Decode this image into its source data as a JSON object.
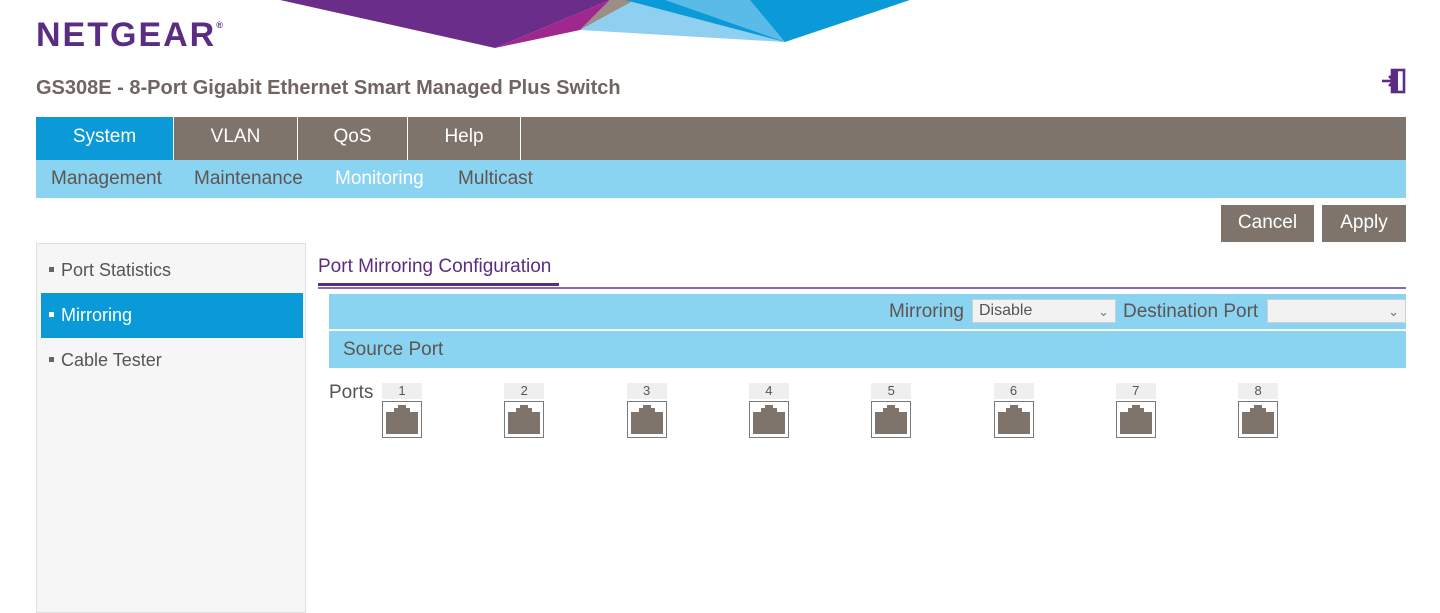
{
  "brand": {
    "logo": "NETGEAR",
    "reg_mark": "®"
  },
  "header": {
    "title": "GS308E - 8-Port Gigabit Ethernet Smart Managed Plus Switch",
    "logout_icon": "logout-icon"
  },
  "main_tabs": [
    {
      "label": "System",
      "active": true
    },
    {
      "label": "VLAN",
      "active": false
    },
    {
      "label": "QoS",
      "active": false
    },
    {
      "label": "Help",
      "active": false
    }
  ],
  "sub_tabs": [
    {
      "label": "Management",
      "active": false
    },
    {
      "label": "Maintenance",
      "active": false
    },
    {
      "label": "Monitoring",
      "active": true
    },
    {
      "label": "Multicast",
      "active": false
    }
  ],
  "actions": {
    "cancel": "Cancel",
    "apply": "Apply"
  },
  "sidebar": {
    "items": [
      {
        "label": "Port Statistics",
        "active": false
      },
      {
        "label": "Mirroring",
        "active": true
      },
      {
        "label": "Cable Tester",
        "active": false
      }
    ]
  },
  "section": {
    "title": "Port Mirroring Configuration",
    "mirroring_label": "Mirroring",
    "mirroring_value": "Disable",
    "destination_label": "Destination Port",
    "destination_value": "",
    "source_label": "Source Port",
    "ports_label": "Ports"
  },
  "ports": [
    "1",
    "2",
    "3",
    "4",
    "5",
    "6",
    "7",
    "8"
  ],
  "colors": {
    "brand_purple": "#5b2d82",
    "nav_gray": "#7f746b",
    "active_blue": "#0a9ad8",
    "light_blue": "#8ad4f2"
  }
}
